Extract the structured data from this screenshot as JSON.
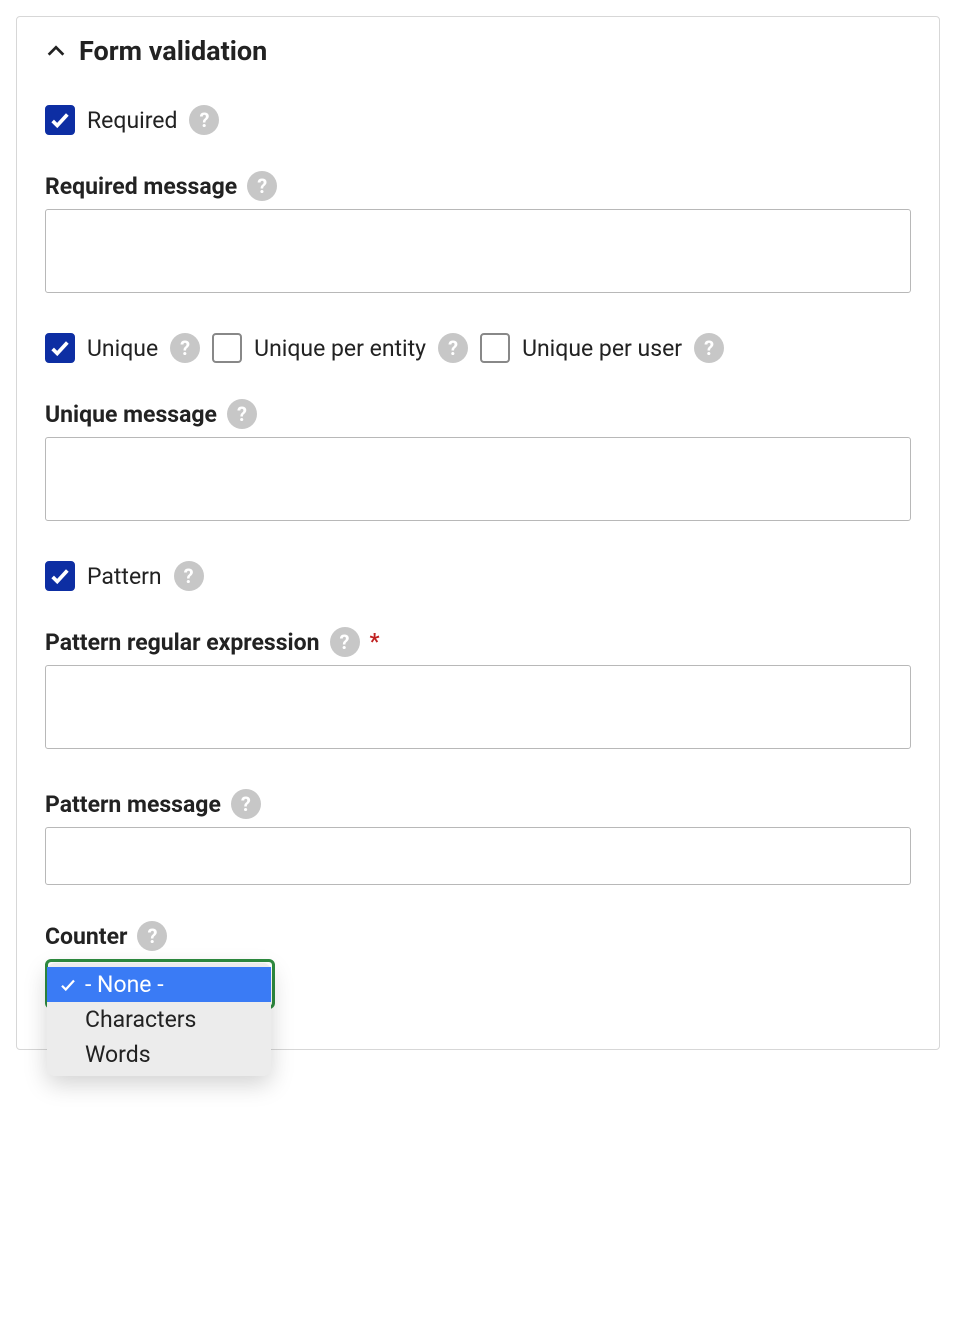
{
  "panel": {
    "title": "Form validation"
  },
  "fields": {
    "required": {
      "label": "Required",
      "checked": true,
      "help": "?"
    },
    "required_message": {
      "label": "Required message",
      "help": "?",
      "value": ""
    },
    "unique": {
      "label": "Unique",
      "checked": true,
      "help": "?"
    },
    "unique_per_entity": {
      "label": "Unique per entity",
      "checked": false,
      "help": "?"
    },
    "unique_per_user": {
      "label": "Unique per user",
      "checked": false,
      "help": "?"
    },
    "unique_message": {
      "label": "Unique message",
      "help": "?",
      "value": ""
    },
    "pattern": {
      "label": "Pattern",
      "checked": true,
      "help": "?"
    },
    "pattern_regex": {
      "label": "Pattern regular expression",
      "help": "?",
      "required_mark": "*",
      "value": ""
    },
    "pattern_message": {
      "label": "Pattern message",
      "help": "?",
      "value": ""
    },
    "counter": {
      "label": "Counter",
      "help": "?",
      "selected": "- None -",
      "options": [
        "- None -",
        "Characters",
        "Words"
      ]
    }
  }
}
